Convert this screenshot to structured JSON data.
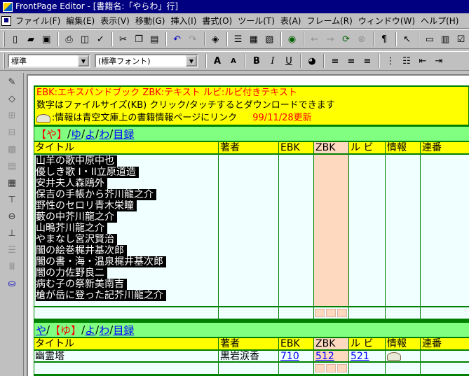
{
  "window": {
    "title": "FrontPage Editor - [書籍名:「やらわ」行]"
  },
  "menu": [
    "ファイル(F)",
    "編集(E)",
    "表示(V)",
    "移動(G)",
    "挿入(I)",
    "書式(O)",
    "ツール(T)",
    "表(A)",
    "フレーム(R)",
    "ウィンドウ(W)",
    "ヘルプ(H)"
  ],
  "format_toolbar": {
    "style_value": "標準",
    "font_value": "(標準フォント)"
  },
  "banner": {
    "line1_red": "EBK:エキスパンドブック  ZBK:テキスト  ルビ:ルビ付きテキスト",
    "line2": "数字はファイルサイズ(KB)  クリック/タッチするとダウンロードできます",
    "line3": ":情報は青空文庫上の書籍情報ページにリンク",
    "updated": "99/11/28更新"
  },
  "section1": {
    "nav": [
      "【や】",
      "ゆ",
      "よ",
      "わ",
      "目録"
    ],
    "headers": [
      "タイトル",
      "著者",
      "EBK",
      "ZBK",
      "ル ビ",
      "情報",
      "連番"
    ],
    "titles": [
      "山羊の歌中原中也",
      "優しき歌 I・II立原道造",
      "安井夫人森鴎外",
      "保吉の手帳から芥川龍之介",
      "野性のセロリ青木栄瞳",
      "藪の中芥川龍之介",
      "山鴫芥川龍之介",
      "やまなし宮沢賢治",
      "闇の絵巻梶井基次郎",
      "闇の書・海・温泉梶井基次郎",
      "闇の力佐野良二",
      "病む子の祭新美南吉",
      "槍が岳に登った記芥川龍之介"
    ]
  },
  "section2": {
    "nav": [
      "や",
      "【ゆ】",
      "よ",
      "わ",
      "目録"
    ],
    "headers": [
      "タイトル",
      "著者",
      "EBK",
      "ZBK",
      "ル ビ",
      "情報",
      "連番"
    ],
    "row": {
      "title": "幽霊塔",
      "author": "黒岩涙香",
      "ebk": "710",
      "zbk": "512",
      "ruby": "521"
    }
  },
  "colors": {
    "banner_bg": "#ffff00",
    "nav_bg": "#80ff80",
    "table_bg": "#f0ffff",
    "zbk_bg": "#ffd8c0",
    "border": "#008000",
    "titlebar": "#000080"
  }
}
